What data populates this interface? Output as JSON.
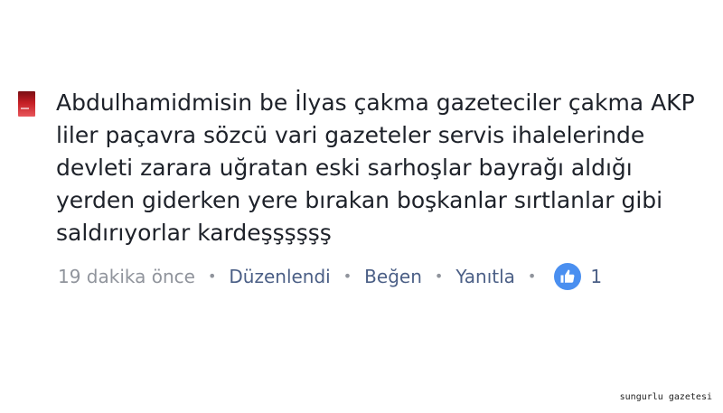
{
  "comment": {
    "text": "Abdulhamidmisin be İlyas çakma gazeteciler çakma AKP liler paçavra sözcü vari gazeteler servis ihalelerinde devleti zarara uğratan eski sarhoşlar bayrağı aldığı yerden giderken yere bırakan boşkanlar sırtlanlar gibi saldırıyorlar kardeşşşşşş",
    "timestamp": "19 dakika önce",
    "separator": "•",
    "edited_label": "Düzenlendi",
    "like_label": "Beğen",
    "reply_label": "Yanıtla",
    "reaction_icon": "thumbs-up-icon",
    "reaction_count": "1"
  },
  "watermark": "sungurlu gazetesi",
  "colors": {
    "text": "#1d2129",
    "meta": "#90949c",
    "action": "#4b5f86",
    "like_badge": "#4a8ff0"
  }
}
